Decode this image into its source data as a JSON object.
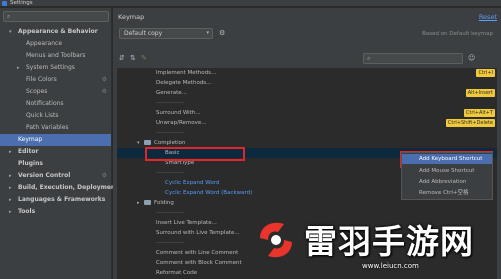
{
  "window": {
    "title": "Settings"
  },
  "sidebar": {
    "search_placeholder": "",
    "items": [
      {
        "label": "Appearance & Behavior",
        "arrow": "▾",
        "bold": true
      },
      {
        "label": "Appearance"
      },
      {
        "label": "Menus and Toolbars"
      },
      {
        "label": "System Settings",
        "arrow": "▸"
      },
      {
        "label": "File Colors",
        "gear": true
      },
      {
        "label": "Scopes",
        "gear": true
      },
      {
        "label": "Notifications"
      },
      {
        "label": "Quick Lists"
      },
      {
        "label": "Path Variables"
      },
      {
        "label": "Keymap",
        "selected": true
      },
      {
        "label": "Editor",
        "arrow": "▸",
        "bold": true
      },
      {
        "label": "Plugins",
        "bold": true
      },
      {
        "label": "Version Control",
        "arrow": "▸",
        "bold": true,
        "gear": true
      },
      {
        "label": "Build, Execution, Deployment",
        "arrow": "▸",
        "bold": true
      },
      {
        "label": "Languages & Frameworks",
        "arrow": "▸",
        "bold": true
      },
      {
        "label": "Tools",
        "arrow": "▸",
        "bold": true
      }
    ]
  },
  "main": {
    "title": "Keymap",
    "reset_label": "Reset",
    "keymap_value": "Default copy",
    "based_on": "Based on Default keymap",
    "filter_placeholder": ""
  },
  "actions": [
    {
      "text": "Implement Methods...",
      "badge": "Ctrl+I"
    },
    {
      "text": "Delegate Methods..."
    },
    {
      "text": "Generate...",
      "badge": "Alt+Insert"
    },
    {
      "text": "--------------",
      "sep": true
    },
    {
      "text": "Surround With...",
      "badge": "Ctrl+Alt+T"
    },
    {
      "text": "Unwrap/Remove...",
      "badge": "Ctrl+Shift+Delete"
    },
    {
      "text": "--------------",
      "sep": true
    },
    {
      "text": "Completion",
      "group": true
    },
    {
      "text": "Basic",
      "basic": true
    },
    {
      "text": "SmartType"
    },
    {
      "text": "--------------",
      "sep": true
    },
    {
      "text": "Cyclic Expand Word",
      "blue": true
    },
    {
      "text": "Cyclic Expand Word (Backward)",
      "blue": true
    },
    {
      "text": "Folding",
      "group": true,
      "closed": true
    },
    {
      "text": "--------------",
      "sep": true
    },
    {
      "text": "Insert Live Template..."
    },
    {
      "text": "Surround with Live Template..."
    },
    {
      "text": "--------------",
      "sep": true
    },
    {
      "text": "Comment with Line Comment"
    },
    {
      "text": "Comment with Block Comment"
    },
    {
      "text": "Reformat Code"
    }
  ],
  "context_menu": {
    "items": [
      {
        "label": "Add Keyboard Shortcut",
        "active": true
      },
      {
        "label": "Add Mouse Shortcut"
      },
      {
        "label": "Add Abbreviation"
      },
      {
        "label": "Remove Ctrl+空格"
      }
    ]
  },
  "watermark": {
    "text": "雷羽手游网",
    "url": "www.leiucn.com"
  },
  "colors": {
    "selection": "#4b6eaf",
    "shortcut_badge": "#f0c93a",
    "highlight_box": "#e0262a",
    "link": "#589df6"
  }
}
